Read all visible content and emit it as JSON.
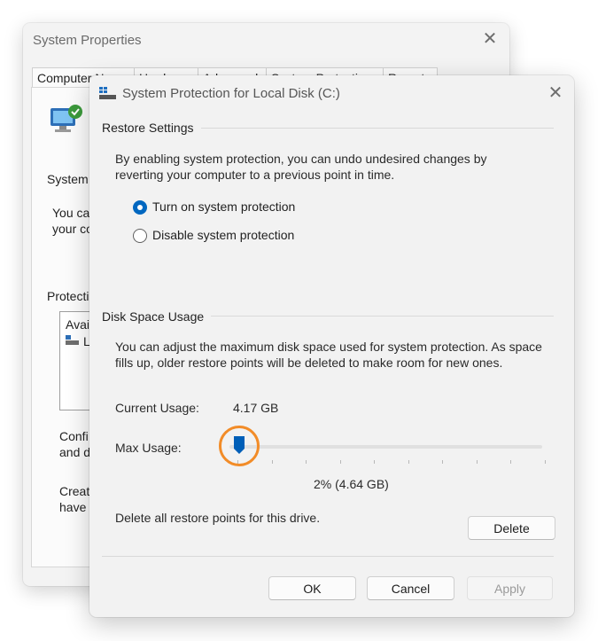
{
  "background_window": {
    "title": "System Properties",
    "tabs": [
      "Computer Name",
      "Hardware",
      "Advanced",
      "System Protection",
      "Remote"
    ],
    "fragments": [
      "System",
      "You ca",
      "your co",
      "Protecti",
      "Avai",
      "L",
      "Confi",
      "and d",
      "Creat",
      "have"
    ]
  },
  "dialog": {
    "title": "System Protection for Local Disk (C:)",
    "restore": {
      "heading": "Restore Settings",
      "description_line1": "By enabling system protection, you can undo undesired changes by",
      "description_line2": "reverting your computer to a previous point in time.",
      "options": [
        {
          "label": "Turn on system protection",
          "selected": true
        },
        {
          "label": "Disable system protection",
          "selected": false
        }
      ]
    },
    "disk": {
      "heading": "Disk Space Usage",
      "description_line1": "You can adjust the maximum disk space used for system protection. As space",
      "description_line2": "fills up, older restore points will be deleted to make room for new ones.",
      "current_label": "Current Usage:",
      "current_value": "4.17 GB",
      "max_label": "Max Usage:",
      "max_value_text": "2% (4.64 GB)",
      "max_percent": 2,
      "delete_text": "Delete all restore points for this drive.",
      "delete_button": "Delete"
    },
    "buttons": {
      "ok": "OK",
      "cancel": "Cancel",
      "apply": "Apply"
    }
  },
  "colors": {
    "accent": "#0067c0",
    "highlight": "#f28c28"
  }
}
